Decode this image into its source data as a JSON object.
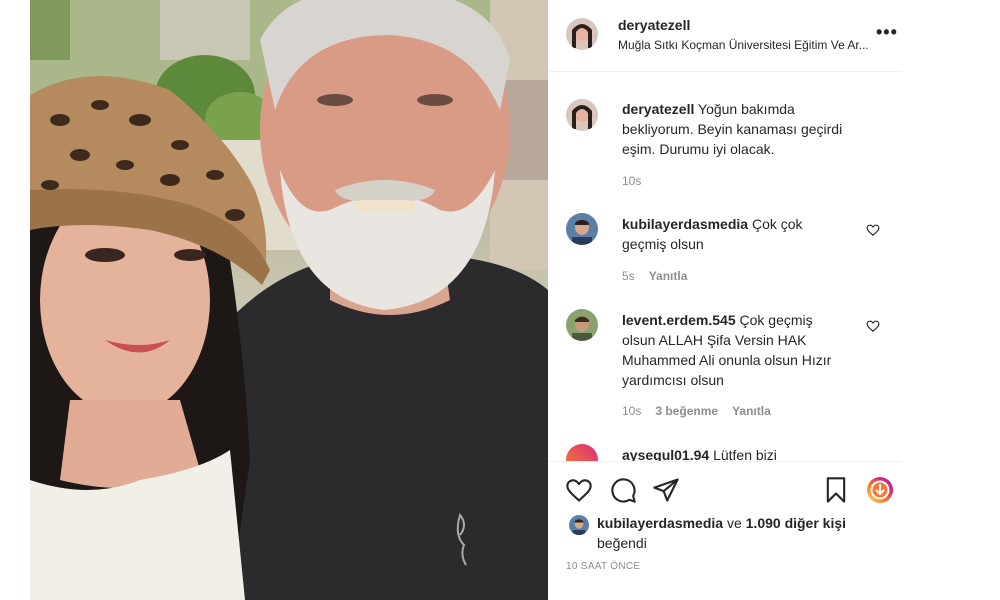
{
  "post": {
    "username": "deryatezell",
    "location": "Muğla Sıtkı Koçman Üniversitesi Eğitim Ve Ar...",
    "more_icon": "more-options-icon"
  },
  "caption": {
    "username": "deryatezell",
    "text": "Yoğun bakımda bekliyorum. Beyin kanaması geçirdi eşim. Durumu iyi olacak.",
    "line1": "Yoğun bakımda",
    "line2": "bekliyorum. Beyin kanaması geçirdi",
    "line3": "eşim. Durumu iyi olacak.",
    "time": "10s"
  },
  "comments": [
    {
      "username": "kubilayerdasmedia",
      "line1": "Çok çok",
      "line2": "geçmiş olsun",
      "time": "5s",
      "reply": "Yanıtla"
    },
    {
      "username": "levent.erdem.545",
      "line1": "Çok geçmiş",
      "line2": "olsun ALLAH Şifa Versin HAK",
      "line3": "Muhammed Ali onunla olsun Hızır",
      "line4": "yardımcısı olsun",
      "time": "10s",
      "likes": "3 beğenme",
      "reply": "Yanıtla"
    },
    {
      "username": "aysegul01.94",
      "line1": "Lütfen bizi"
    }
  ],
  "likes": {
    "user": "kubilayerdasmedia",
    "connector": "ve",
    "others": "1.090 diğer kişi",
    "suffix": "beğendi"
  },
  "timestamp": "10 SAAT ÖNCE",
  "icons": {
    "like": "heart-icon",
    "comment": "comment-icon",
    "share": "share-icon",
    "save": "bookmark-icon",
    "badge": "instagram-badge-icon"
  },
  "colors": {
    "text": "#262626",
    "muted": "#8e8e8e",
    "border": "#efefef"
  }
}
